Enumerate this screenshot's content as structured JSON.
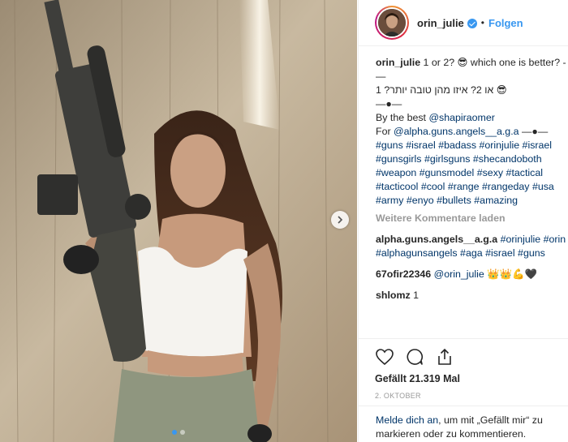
{
  "post": {
    "username": "orin_julie",
    "follow_label": "Folgen",
    "caption_lines": [
      [
        {
          "t": "u",
          "v": "orin_julie"
        },
        {
          "t": "x",
          "v": " 1 or 2? 😎 which one is better? -"
        }
      ],
      [
        {
          "t": "x",
          "v": "—"
        }
      ],
      [
        {
          "t": "x",
          "v": "או 2? איזו מהן טובה יותר? 1 😎"
        }
      ],
      [
        {
          "t": "x",
          "v": "—●—"
        }
      ],
      [
        {
          "t": "x",
          "v": "By the best "
        },
        {
          "t": "h",
          "v": "@shapiraomer"
        }
      ],
      [
        {
          "t": "x",
          "v": "For "
        },
        {
          "t": "h",
          "v": "@alpha.guns.angels__a.g.a"
        },
        {
          "t": "x",
          "v": " —●—"
        }
      ],
      [
        {
          "t": "h",
          "v": "#guns"
        },
        {
          "t": "x",
          "v": " "
        },
        {
          "t": "h",
          "v": "#israel"
        },
        {
          "t": "x",
          "v": " "
        },
        {
          "t": "h",
          "v": "#badass"
        },
        {
          "t": "x",
          "v": " "
        },
        {
          "t": "h",
          "v": "#orinjulie"
        },
        {
          "t": "x",
          "v": " "
        },
        {
          "t": "h",
          "v": "#israel"
        }
      ],
      [
        {
          "t": "h",
          "v": "#gunsgirls"
        },
        {
          "t": "x",
          "v": " "
        },
        {
          "t": "h",
          "v": "#girlsguns"
        },
        {
          "t": "x",
          "v": " "
        },
        {
          "t": "h",
          "v": "#shecandoboth"
        }
      ],
      [
        {
          "t": "h",
          "v": "#weapon"
        },
        {
          "t": "x",
          "v": " "
        },
        {
          "t": "h",
          "v": "#gunsmodel"
        },
        {
          "t": "x",
          "v": " "
        },
        {
          "t": "h",
          "v": "#sexy"
        },
        {
          "t": "x",
          "v": " "
        },
        {
          "t": "h",
          "v": "#tactical"
        }
      ],
      [
        {
          "t": "h",
          "v": "#tacticool"
        },
        {
          "t": "x",
          "v": " "
        },
        {
          "t": "h",
          "v": "#cool"
        },
        {
          "t": "x",
          "v": " "
        },
        {
          "t": "h",
          "v": "#range"
        },
        {
          "t": "x",
          "v": " "
        },
        {
          "t": "h",
          "v": "#rangeday"
        },
        {
          "t": "x",
          "v": " "
        },
        {
          "t": "h",
          "v": "#usa"
        }
      ],
      [
        {
          "t": "h",
          "v": "#army"
        },
        {
          "t": "x",
          "v": " "
        },
        {
          "t": "h",
          "v": "#enyo"
        },
        {
          "t": "x",
          "v": " "
        },
        {
          "t": "h",
          "v": "#bullets"
        },
        {
          "t": "x",
          "v": " "
        },
        {
          "t": "h",
          "v": "#amazing"
        }
      ]
    ],
    "load_more_label": "Weitere Kommentare laden",
    "comments": [
      [
        [
          {
            "t": "u",
            "v": "alpha.guns.angels__a.g.a"
          },
          {
            "t": "x",
            "v": " "
          },
          {
            "t": "h",
            "v": "#orinjulie"
          },
          {
            "t": "x",
            "v": " "
          },
          {
            "t": "h",
            "v": "#orin"
          }
        ],
        [
          {
            "t": "h",
            "v": "#alphagunsangels"
          },
          {
            "t": "x",
            "v": " "
          },
          {
            "t": "h",
            "v": "#aga"
          },
          {
            "t": "x",
            "v": " "
          },
          {
            "t": "h",
            "v": "#israel"
          },
          {
            "t": "x",
            "v": " "
          },
          {
            "t": "h",
            "v": "#guns"
          }
        ]
      ],
      [
        [
          {
            "t": "u",
            "v": "67ofir22346"
          },
          {
            "t": "x",
            "v": " "
          },
          {
            "t": "h",
            "v": "@orin_julie"
          },
          {
            "t": "x",
            "v": " 👑👑💪🖤"
          }
        ]
      ],
      [
        [
          {
            "t": "u",
            "v": "shlomz"
          },
          {
            "t": "x",
            "v": " 1"
          }
        ]
      ]
    ],
    "likes_text": "Gefällt 21.319 Mal",
    "date_text": "2. Oktober",
    "login_link": "Melde dich an",
    "login_rest": ", um mit „Gefällt mir“ zu markieren oder zu kommentieren.",
    "carousel": {
      "total": 2,
      "current": 1
    }
  },
  "colors": {
    "accent": "#3897f0",
    "link": "#003569",
    "muted": "#999999"
  },
  "icons": [
    "verified-badge-icon",
    "chevron-right-icon",
    "heart-icon",
    "comment-icon",
    "share-icon"
  ]
}
